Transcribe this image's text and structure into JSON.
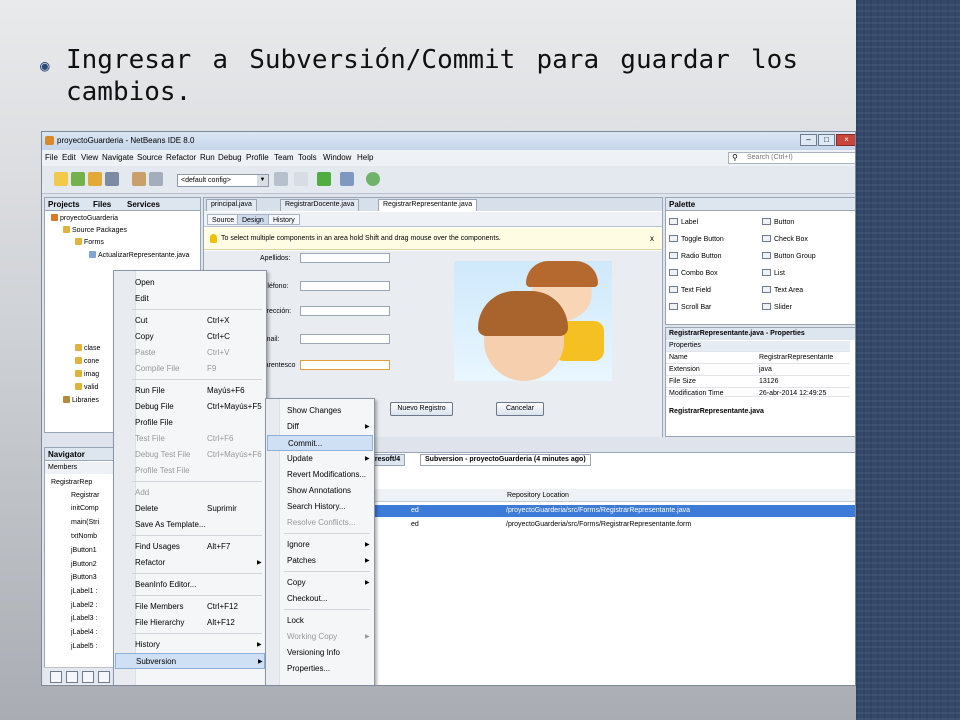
{
  "slide": {
    "bullet_line1": "Ingresar a Subversión/Commit para guardar los",
    "bullet_line2": "cambios.",
    "band_color": "#34496a"
  },
  "window": {
    "title": "proyectoGuarderia - NetBeans IDE 8.0",
    "min": "–",
    "max": "□",
    "close": "×"
  },
  "menubar": [
    "File",
    "Edit",
    "View",
    "Navigate",
    "Source",
    "Refactor",
    "Run",
    "Debug",
    "Profile",
    "Team",
    "Tools",
    "Window",
    "Help"
  ],
  "search": {
    "placeholder": "Search (Ctrl+I)"
  },
  "toolbar": {
    "config": "<default config>"
  },
  "projects_panel": {
    "tabs": [
      "Projects",
      "Files",
      "Services"
    ],
    "tree": [
      "proyectoGuarderia",
      "Source Packages",
      "Forms",
      "ActualizarRepresentante.java",
      "clase",
      "cone",
      "imag",
      "valid",
      "Libraries"
    ]
  },
  "editor": {
    "tabs": [
      "principal.java",
      "RegistrarDocente.java",
      "RegistrarRepresentante.java"
    ],
    "subtabs": [
      "Source",
      "Design",
      "History"
    ],
    "hint": "To select multiple components in an area hold Shift and drag mouse over the components.",
    "hint_close": "x",
    "labels": [
      "Apellidos:",
      "Teléfono:",
      "Dirección:",
      "Email:",
      "Parentesco"
    ],
    "buttons": {
      "new": "Nuevo Registro",
      "cancel": "Cancelar"
    }
  },
  "palette": {
    "title": "Palette",
    "items": [
      [
        "Label",
        "Button"
      ],
      [
        "Toggle Button",
        "Check Box"
      ],
      [
        "Radio Button",
        "Button Group"
      ],
      [
        "Combo Box",
        "List"
      ],
      [
        "Text Field",
        "Text Area"
      ],
      [
        "Scroll Bar",
        "Slider"
      ]
    ]
  },
  "properties": {
    "title": "RegistrarRepresentante.java - Properties",
    "section": "Properties",
    "rows": [
      [
        "Name",
        "RegistrarRepresentante"
      ],
      [
        "Extension",
        "java"
      ],
      [
        "File Size",
        "13126"
      ],
      [
        "Modification Time",
        "26-abr-2014 12:49:25"
      ]
    ],
    "footer": "RegistrarRepresentante.java"
  },
  "navigator": {
    "tabs": [
      "Navigator",
      "Members"
    ],
    "rows": [
      "RegistrarRep",
      "Registrar",
      "initComp",
      "main(Stri",
      "txtNomb",
      "jButton1",
      "jButton2",
      "jButton3",
      "jLabel1 :",
      "jLabel2 :",
      "jLabel3 :",
      "jLabel4 :",
      "jLabel5 :"
    ]
  },
  "output": {
    "tab1": "aresoft/4",
    "tab2": "Subversion - proyectoGuarderia (4 minutes ago)",
    "col_repo": "Repository Location",
    "rows": [
      [
        "ed",
        "/proyectoGuarderia/src/Forms/RegistrarRepresentante.java"
      ],
      [
        "ed",
        "/proyectoGuarderia/src/Forms/RegistrarRepresentante.form"
      ]
    ]
  },
  "context_menu": [
    {
      "label": "Open",
      "sc": ""
    },
    {
      "label": "Edit",
      "sc": ""
    },
    {
      "sep": true
    },
    {
      "label": "Cut",
      "sc": "Ctrl+X"
    },
    {
      "label": "Copy",
      "sc": "Ctrl+C"
    },
    {
      "label": "Paste",
      "sc": "Ctrl+V",
      "disabled": true
    },
    {
      "label": "Compile File",
      "sc": "F9",
      "disabled": true
    },
    {
      "sep": true
    },
    {
      "label": "Run File",
      "sc": "Mayús+F6"
    },
    {
      "label": "Debug File",
      "sc": "Ctrl+Mayús+F5"
    },
    {
      "label": "Profile File",
      "sc": ""
    },
    {
      "label": "Test File",
      "sc": "Ctrl+F6",
      "disabled": true
    },
    {
      "label": "Debug Test File",
      "sc": "Ctrl+Mayús+F6",
      "disabled": true
    },
    {
      "label": "Profile Test File",
      "sc": "",
      "disabled": true
    },
    {
      "sep": true
    },
    {
      "label": "Add",
      "sc": "",
      "disabled": true
    },
    {
      "label": "Delete",
      "sc": "Suprimir"
    },
    {
      "label": "Save As Template...",
      "sc": ""
    },
    {
      "sep": true
    },
    {
      "label": "Find Usages",
      "sc": "Alt+F7"
    },
    {
      "label": "Refactor",
      "sc": "",
      "sub": true
    },
    {
      "sep": true
    },
    {
      "label": "BeanInfo Editor...",
      "sc": ""
    },
    {
      "sep": true
    },
    {
      "label": "File Members",
      "sc": "Ctrl+F12"
    },
    {
      "label": "File Hierarchy",
      "sc": "Alt+F12"
    },
    {
      "sep": true
    },
    {
      "label": "History",
      "sc": "",
      "sub": true
    },
    {
      "label": "Subversion",
      "sc": "",
      "sub": true,
      "hl": true
    }
  ],
  "submenu": [
    {
      "label": "Show Changes"
    },
    {
      "label": "Diff",
      "sub": true
    },
    {
      "label": "Commit...",
      "hl": true
    },
    {
      "label": "Update",
      "sub": true
    },
    {
      "label": "Revert Modifications..."
    },
    {
      "label": "Show Annotations"
    },
    {
      "label": "Search History..."
    },
    {
      "label": "Resolve Conflicts...",
      "disabled": true
    },
    {
      "sep": true
    },
    {
      "label": "Ignore",
      "sub": true
    },
    {
      "label": "Patches",
      "sub": true
    },
    {
      "sep": true
    },
    {
      "label": "Copy",
      "sub": true
    },
    {
      "label": "Checkout..."
    },
    {
      "sep": true
    },
    {
      "label": "Lock"
    },
    {
      "label": "Working Copy",
      "sub": true,
      "disabled": true
    },
    {
      "label": "Versioning Info"
    },
    {
      "label": "Properties..."
    }
  ]
}
